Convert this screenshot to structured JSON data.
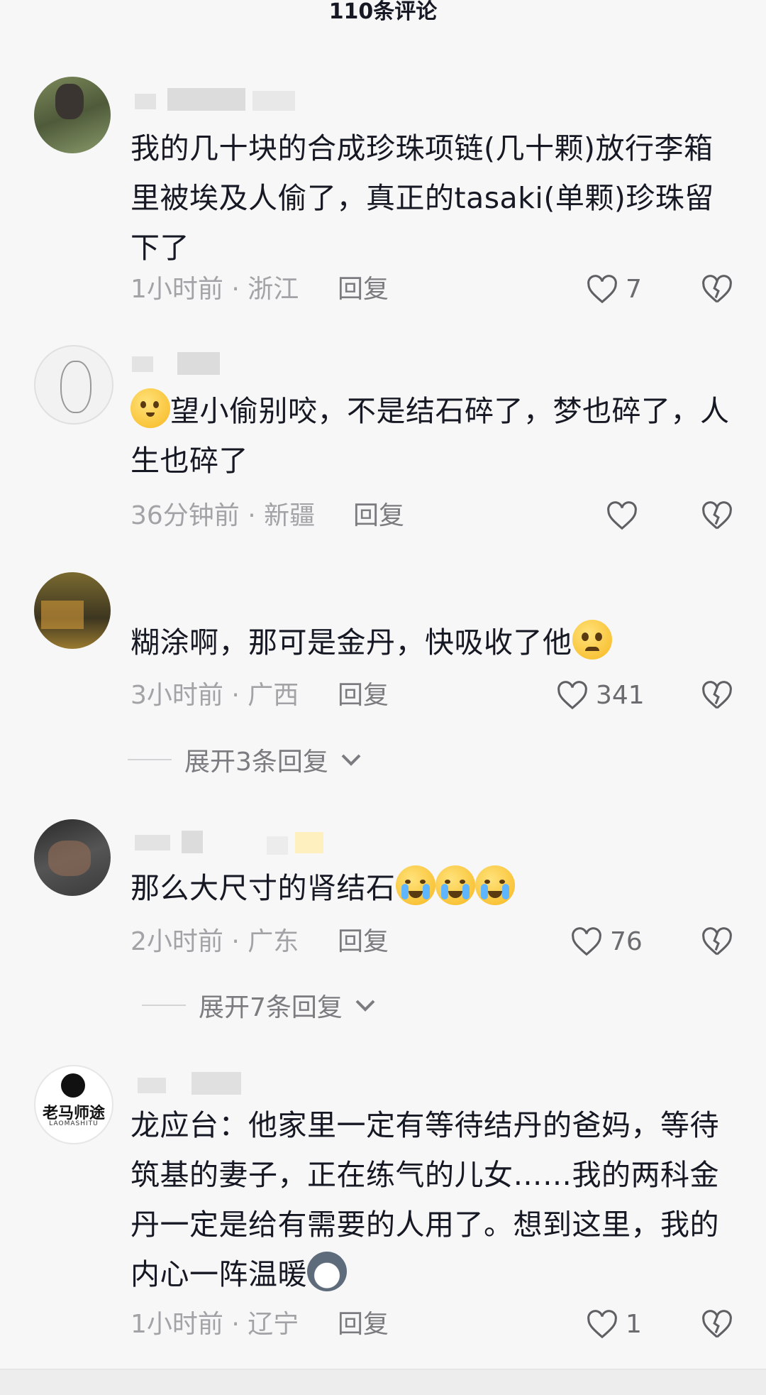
{
  "header": {
    "title": "110条评论"
  },
  "colors": {
    "text": "#161823",
    "meta": "#a3a3a7",
    "reply": "#7b7b80",
    "background": "#f7f7f7"
  },
  "comments": [
    {
      "text": "我的几十块的合成珍珠项链(几十颗)放行李箱里被埃及人偷了，真正的tasaki(单颗)珍珠留下了",
      "time_location": "1小时前 · 浙江",
      "reply_label": "回复",
      "likes": "7"
    },
    {
      "emoji": "pouting-face",
      "text": "望小偷别咬，不是结石碎了，梦也碎了，人生也碎了",
      "time_location": "36分钟前 · 新疆",
      "reply_label": "回复",
      "likes": ""
    },
    {
      "text": "糊涂啊，那可是金丹，快吸收了他",
      "emoji": "pleading-face",
      "time_location": "3小时前 · 广西",
      "reply_label": "回复",
      "likes": "341",
      "expand_label": "展开3条回复"
    },
    {
      "text": "那么大尺寸的肾结石",
      "emoji": "crying-face x3",
      "time_location": "2小时前 · 广东",
      "reply_label": "回复",
      "likes": "76",
      "expand_label": "展开7条回复"
    },
    {
      "avatar_text": "老马师途",
      "avatar_subtext": "LAOMASHITU",
      "text": "龙应台：他家里一定有等待结丹的爸妈，等待筑基的妻子，正在练气的儿女……我的两科金丹一定是给有需要的人用了。想到这里，我的内心一阵温暖",
      "emoji": "husky-face",
      "time_location": "1小时前 · 辽宁",
      "reply_label": "回复",
      "likes": "1"
    }
  ]
}
